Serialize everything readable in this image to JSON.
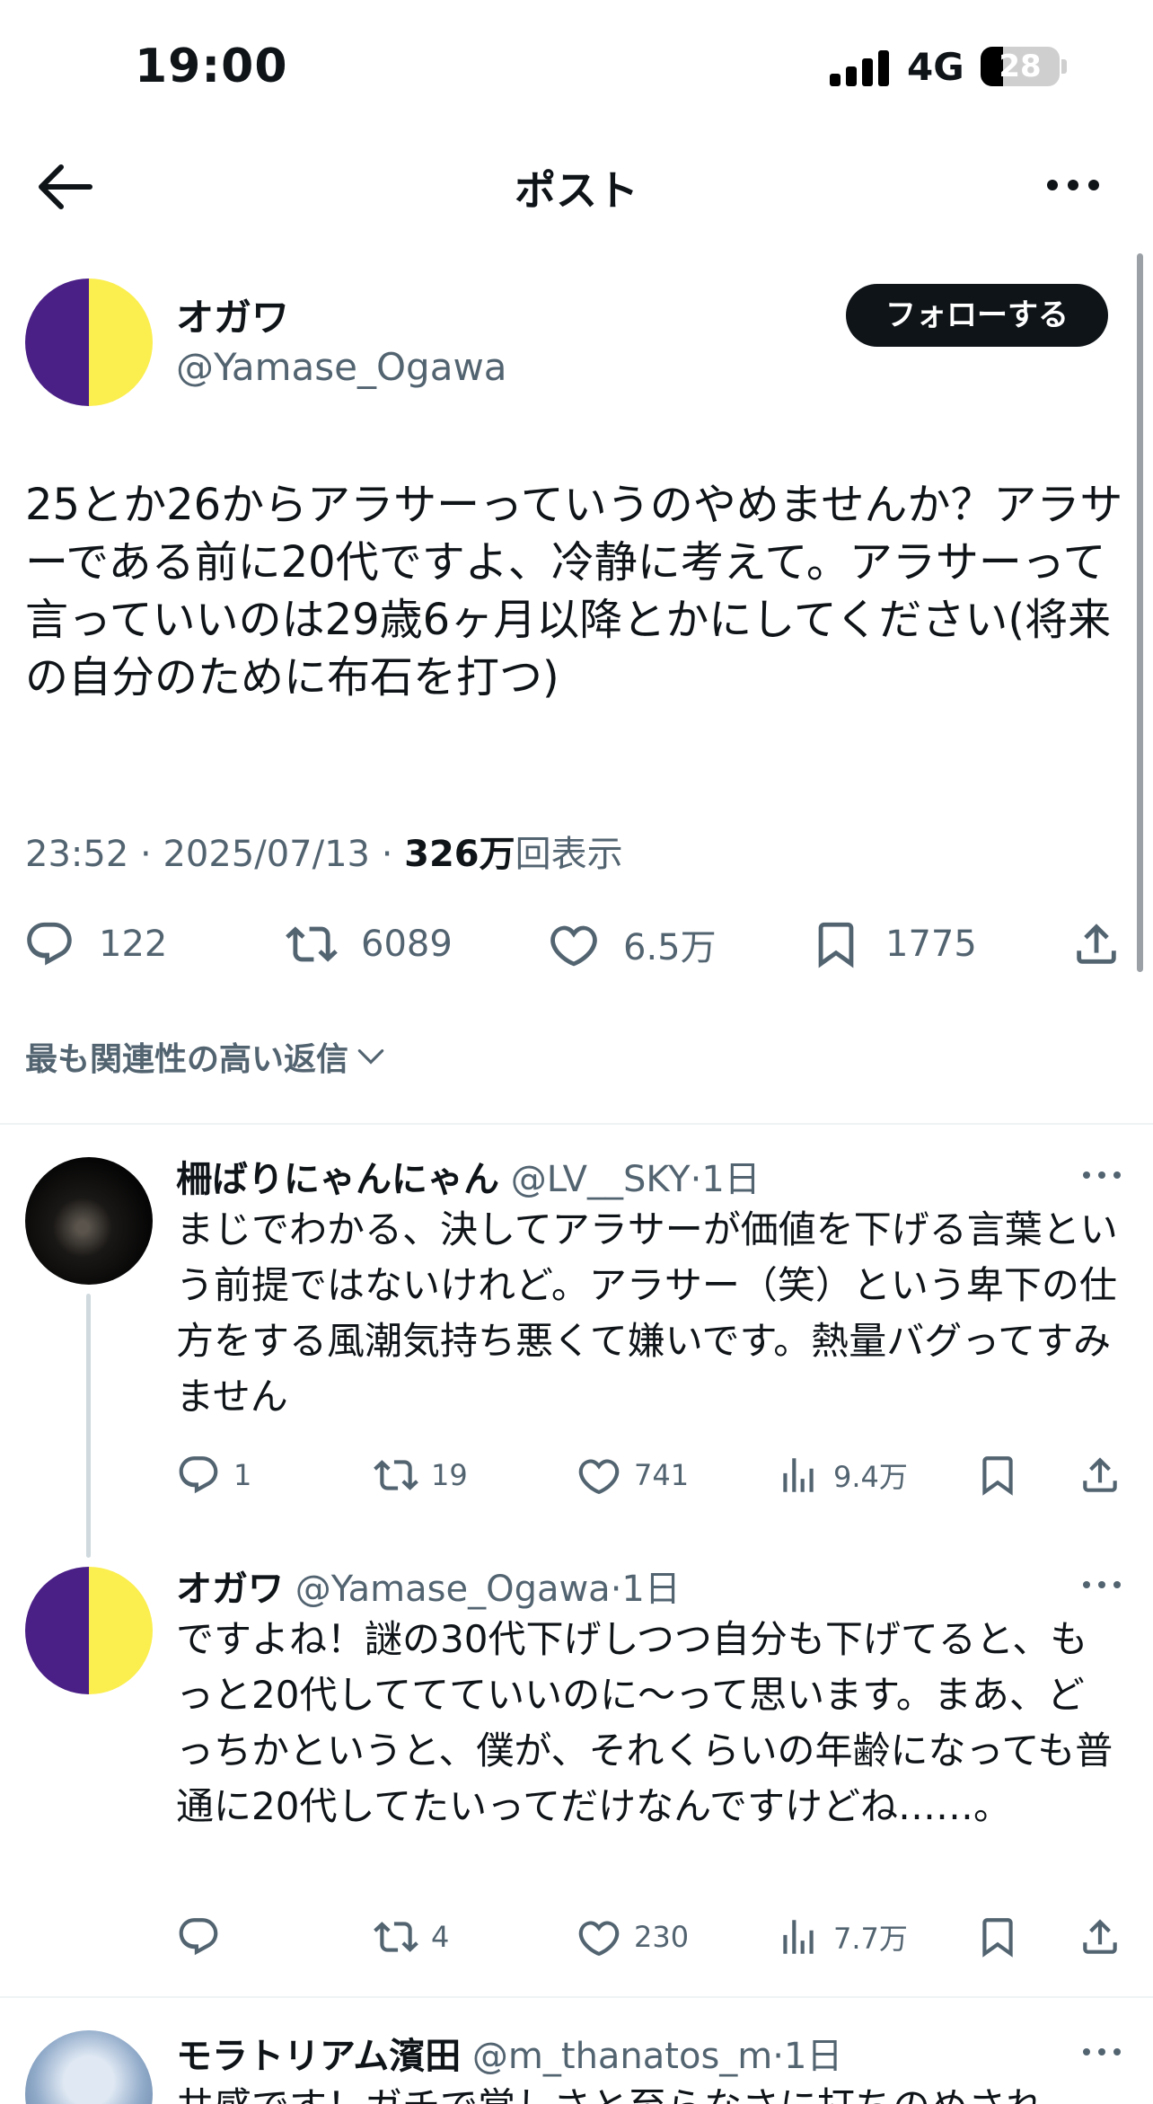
{
  "status_bar": {
    "time": "19:00",
    "network": "4G",
    "battery": "28",
    "battery_level": 0.28
  },
  "nav": {
    "title": "ポスト"
  },
  "post": {
    "author_name": "オガワ",
    "author_handle": "@Yamase_Ogawa",
    "follow_label": "フォローする",
    "text": "25とか26からアラサーっていうのやめませんか？アラサーである前に20代ですよ、冷静に考えて。アラサーって言っていいのは29歳6ヶ月以降とかにしてください(将来の自分のために布石を打つ)",
    "time": "23:52",
    "sep1": " · ",
    "date": "2025/07/13",
    "sep2": " · ",
    "views_count": "326万",
    "views_label": "回表示",
    "replies": "122",
    "reposts": "6089",
    "likes": "6.5万",
    "bookmarks": "1775"
  },
  "sort": {
    "label": "最も関連性の高い返信"
  },
  "replies": [
    {
      "name": "柵ばりにゃんにゃん",
      "handle": "@LV__SKY",
      "dot": "·",
      "time": "1日",
      "text": "まじでわかる、決してアラサーが価値を下げる言葉という前提ではないけれど。アラサー（笑）という卑下の仕方をする風潮気持ち悪くて嫌いです。熱量バグってすみません",
      "replies": "1",
      "reposts": "19",
      "likes": "741",
      "views": "9.4万"
    },
    {
      "name": "オガワ",
      "handle": "@Yamase_Ogawa",
      "dot": "·",
      "time": "1日",
      "text": "ですよね！謎の30代下げしつつ自分も下げてると、もっと20代しててていいのに〜って思います。まあ、どっちかというと、僕が、それくらいの年齢になっても普通に20代してたいってだけなんですけどね……。",
      "replies": "",
      "reposts": "4",
      "likes": "230",
      "views": "7.7万"
    },
    {
      "name": "モラトリアム濱田",
      "handle": "@m_thanatos_m",
      "dot": "·",
      "time": "1日",
      "text": "共感です！ガチで覚しさと至らなさに打ちのめされ"
    }
  ],
  "icons": {
    "back": "arrow-left-icon",
    "more": "more-horizontal-icon",
    "reply": "speech-bubble-icon",
    "repost": "repost-arrows-icon",
    "like": "heart-icon",
    "bookmark": "bookmark-icon",
    "share": "share-upload-icon",
    "views": "bar-chart-icon",
    "chevron": "chevron-down-icon"
  },
  "colors": {
    "text": "#0f1419",
    "secondary": "#536471",
    "follow_button": "#0f1419",
    "avatar_purple": "#4a1f86",
    "avatar_yellow": "#fbee4f",
    "divider": "#eff3f4"
  }
}
